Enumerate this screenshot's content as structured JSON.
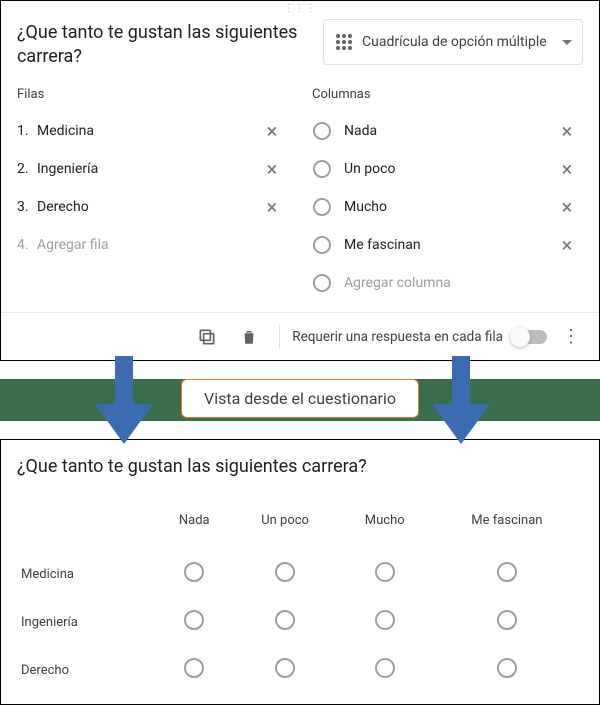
{
  "editor": {
    "question_title": "¿Que tanto te gustan las siguientes carrera?",
    "type_label": "Cuadrícula de opción múltiple",
    "rows_heading": "Filas",
    "cols_heading": "Columnas",
    "rows": [
      {
        "index": "1.",
        "label": "Medicina"
      },
      {
        "index": "2.",
        "label": "Ingeniería"
      },
      {
        "index": "3.",
        "label": "Derecho"
      }
    ],
    "add_row": {
      "index": "4.",
      "label": "Agregar fila"
    },
    "columns": [
      {
        "label": "Nada"
      },
      {
        "label": "Un poco"
      },
      {
        "label": "Mucho"
      },
      {
        "label": "Me fascinan"
      }
    ],
    "add_column": {
      "label": "Agregar columna"
    },
    "footer": {
      "require_label": "Requerir una respuesta en cada fila",
      "switch_on": false
    }
  },
  "callout": {
    "label": "Vista desde el cuestionario"
  },
  "preview": {
    "title": "¿Que tanto te gustan las siguientes carrera?",
    "columns": [
      "Nada",
      "Un poco",
      "Mucho",
      "Me fascinan"
    ],
    "rows": [
      "Medicina",
      "Ingeniería",
      "Derecho"
    ]
  }
}
